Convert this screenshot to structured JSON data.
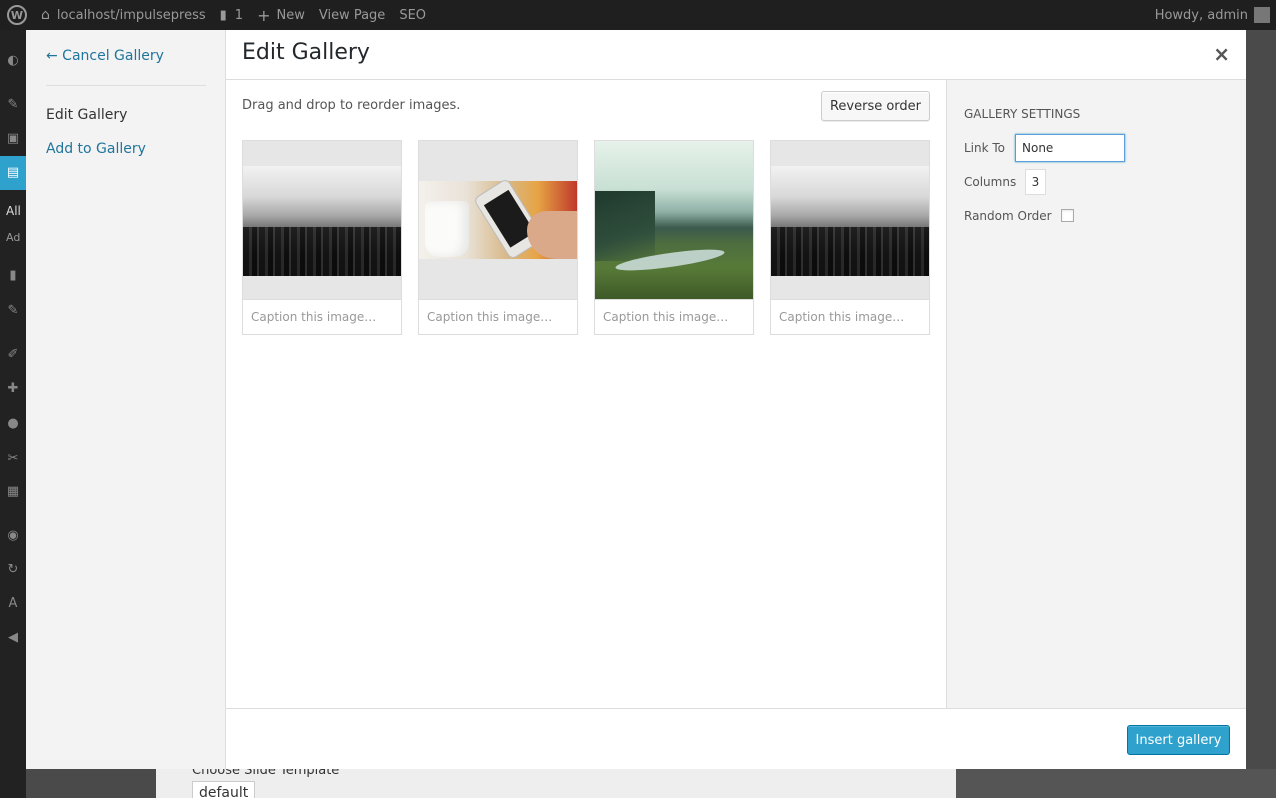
{
  "adminbar": {
    "site": "localhost/impulsepress",
    "comments_count": "1",
    "new_label": "New",
    "view_page": "View Page",
    "seo": "SEO",
    "howdy": "Howdy, admin"
  },
  "adminmenu": {
    "sub_all": "All",
    "sub_add": "Ad"
  },
  "behind": {
    "template_label": "Choose Slide Template",
    "template_value": "default"
  },
  "menu": {
    "cancel": "← Cancel Gallery",
    "edit": "Edit Gallery",
    "add": "Add to Gallery"
  },
  "title": "Edit Gallery",
  "close_glyph": "×",
  "content": {
    "instructions": "Drag and drop to reorder images.",
    "reverse_label": "Reverse order",
    "images": [
      {
        "kind": "city",
        "caption_placeholder": "Caption this image…"
      },
      {
        "kind": "phone",
        "caption_placeholder": "Caption this image…"
      },
      {
        "kind": "landscape",
        "caption_placeholder": "Caption this image…"
      },
      {
        "kind": "city",
        "caption_placeholder": "Caption this image…"
      }
    ]
  },
  "settings": {
    "title": "Gallery Settings",
    "link_to_label": "Link To",
    "link_to_value": "None",
    "columns_label": "Columns",
    "columns_value": "3",
    "random_label": "Random Order",
    "random_checked": false
  },
  "toolbar": {
    "insert_label": "Insert gallery"
  },
  "colors": {
    "accent": "#2ea2cc",
    "link": "#21759b",
    "adminbar_bg": "#1f1f1f"
  }
}
